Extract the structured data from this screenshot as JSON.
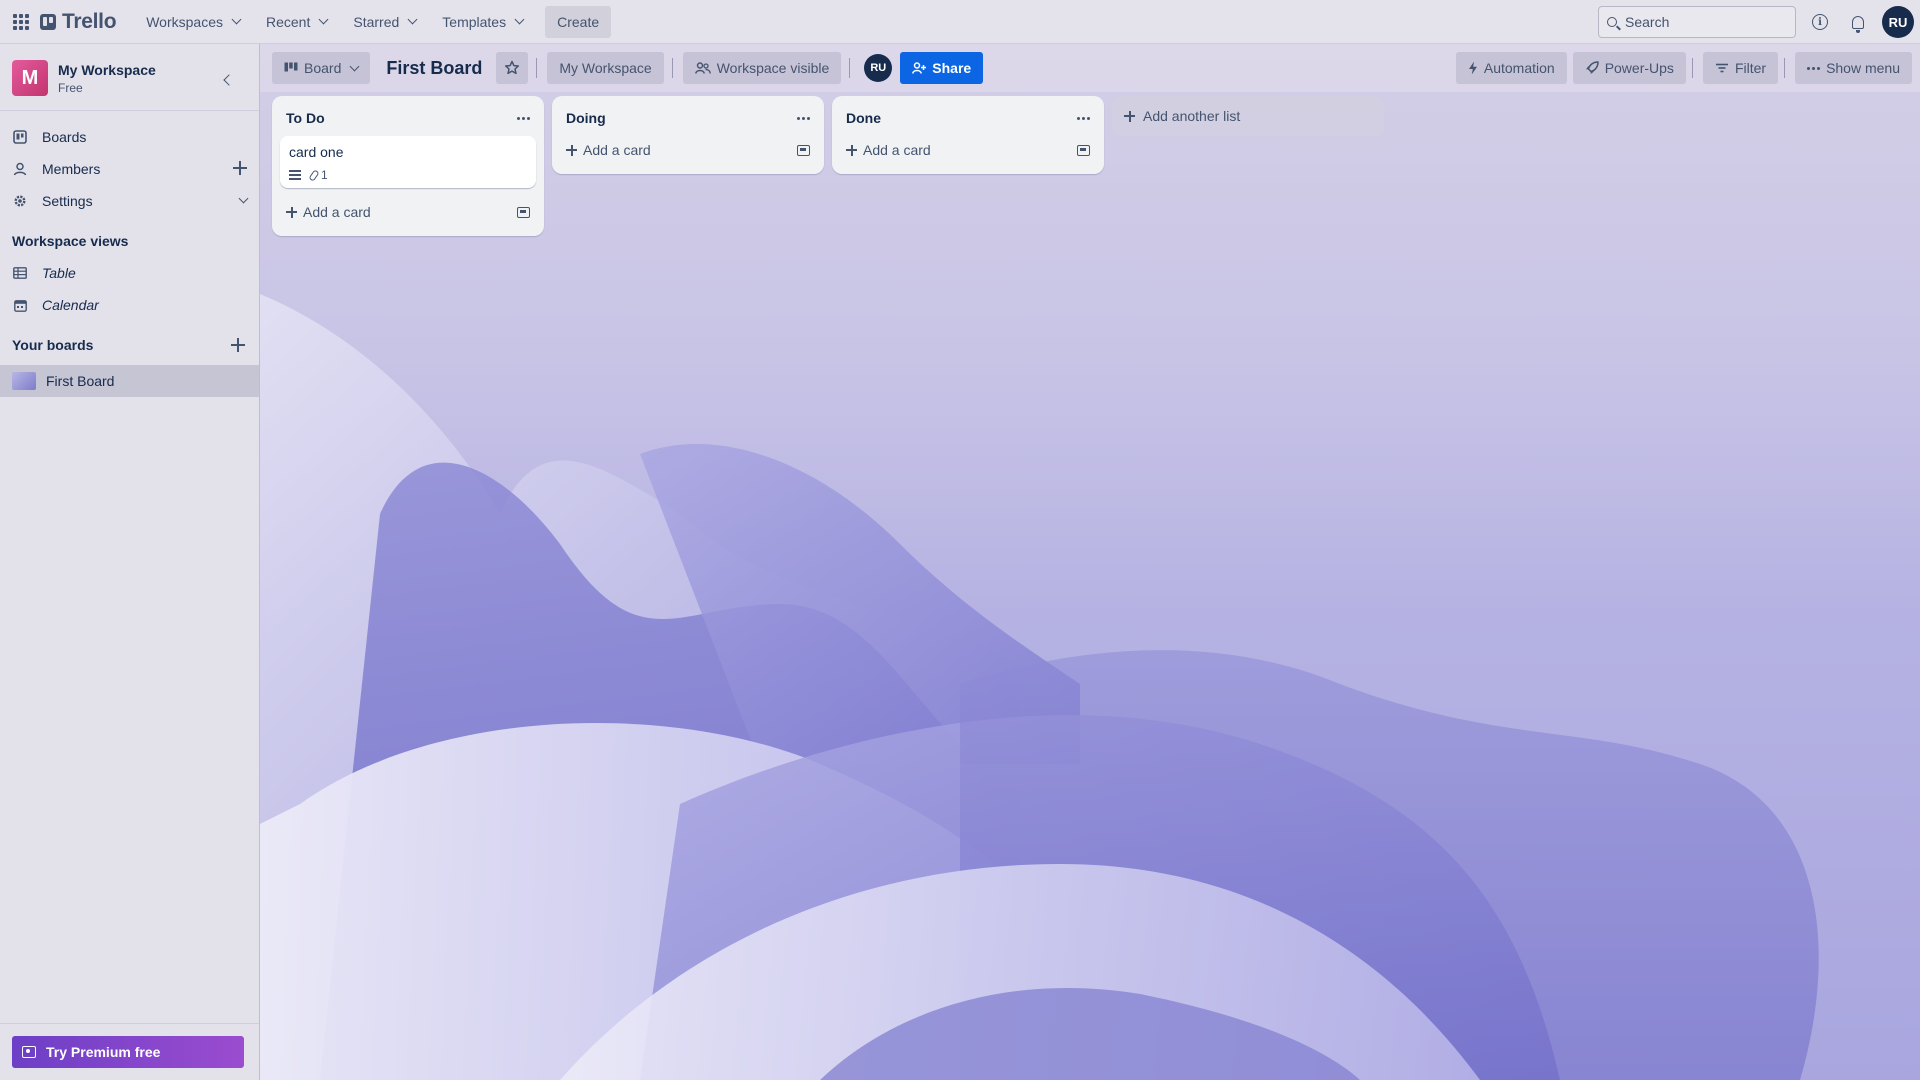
{
  "topbar": {
    "logo": "Trello",
    "menus": [
      "Workspaces",
      "Recent",
      "Starred",
      "Templates"
    ],
    "create": "Create",
    "search_placeholder": "Search",
    "avatar": "RU"
  },
  "sidebar": {
    "workspace_initial": "M",
    "workspace_name": "My Workspace",
    "workspace_plan": "Free",
    "nav": [
      "Boards",
      "Members",
      "Settings"
    ],
    "views_heading": "Workspace views",
    "views": [
      "Table",
      "Calendar"
    ],
    "boards_heading": "Your boards",
    "boards": [
      "First Board"
    ],
    "premium": "Try Premium free"
  },
  "board": {
    "view": "Board",
    "title": "First Board",
    "workspace": "My Workspace",
    "visibility": "Workspace visible",
    "member_avatar": "RU",
    "share": "Share",
    "automation": "Automation",
    "powerups": "Power-Ups",
    "filter": "Filter",
    "show_menu": "Show menu",
    "add_list": "Add another list",
    "add_card": "Add a card",
    "lists": [
      {
        "title": "To Do",
        "cards": [
          {
            "title": "card one",
            "attachments": "1"
          }
        ]
      },
      {
        "title": "Doing",
        "cards": []
      },
      {
        "title": "Done",
        "cards": []
      }
    ]
  },
  "colors": {
    "share_button": "#0c66e4",
    "premium_start": "#6c3fc6",
    "premium_end": "#9b4ccf",
    "workspace_logo": "#e35a9c"
  }
}
